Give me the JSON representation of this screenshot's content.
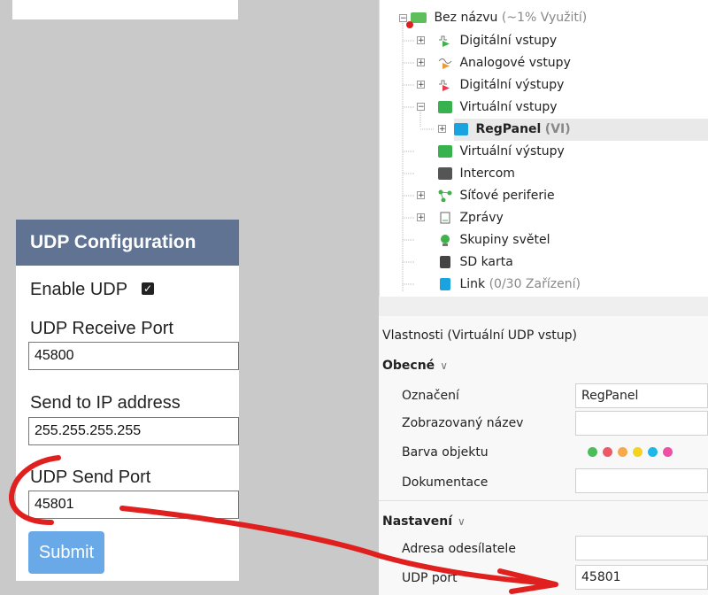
{
  "udp_form": {
    "title": "UDP Configuration",
    "enable_label": "Enable UDP",
    "enabled": true,
    "receive_port_label": "UDP Receive Port",
    "receive_port_value": "45800",
    "send_ip_label": "Send to IP address",
    "send_ip_value": "255.255.255.255",
    "send_port_label": "UDP Send Port",
    "send_port_value": "45801",
    "submit_label": "Submit"
  },
  "tree": {
    "root_label": "Bez názvu",
    "root_usage": "(~1% Využití)",
    "items": [
      {
        "label": "Digitální vstupy",
        "icon": "digital-input-icon"
      },
      {
        "label": "Analogové vstupy",
        "icon": "analog-input-icon"
      },
      {
        "label": "Digitální výstupy",
        "icon": "digital-output-icon"
      },
      {
        "label": "Virtuální vstupy",
        "icon": "virtual-input-icon"
      },
      {
        "label": "RegPanel",
        "suffix": "(VI)",
        "icon": "virtual-input-item-icon",
        "selected": true
      },
      {
        "label": "Virtuální výstupy",
        "icon": "virtual-output-icon"
      },
      {
        "label": "Intercom",
        "icon": "intercom-icon"
      },
      {
        "label": "Síťové periferie",
        "icon": "network-icon"
      },
      {
        "label": "Zprávy",
        "icon": "messages-icon"
      },
      {
        "label": "Skupiny světel",
        "icon": "light-groups-icon"
      },
      {
        "label": "SD karta",
        "icon": "sd-card-icon"
      },
      {
        "label": "Link",
        "suffix": "(0/30 Zařízení)",
        "icon": "link-icon"
      }
    ]
  },
  "properties": {
    "title": "Vlastnosti (Virtuální UDP vstup)",
    "general_section": "Obecné",
    "label_designation": "Označení",
    "value_designation": "RegPanel",
    "label_display_name": "Zobrazovaný název",
    "label_object_color": "Barva objektu",
    "colors": [
      "#4cbb5a",
      "#ef5865",
      "#f5a94d",
      "#f4d21e",
      "#1fb6e8",
      "#ef4fa4"
    ],
    "label_documentation": "Dokumentace",
    "settings_section": "Nastavení",
    "label_sender_address": "Adresa odesílatele",
    "label_udp_port": "UDP port",
    "value_udp_port": "45801"
  },
  "annotation_color": "#e0201f"
}
